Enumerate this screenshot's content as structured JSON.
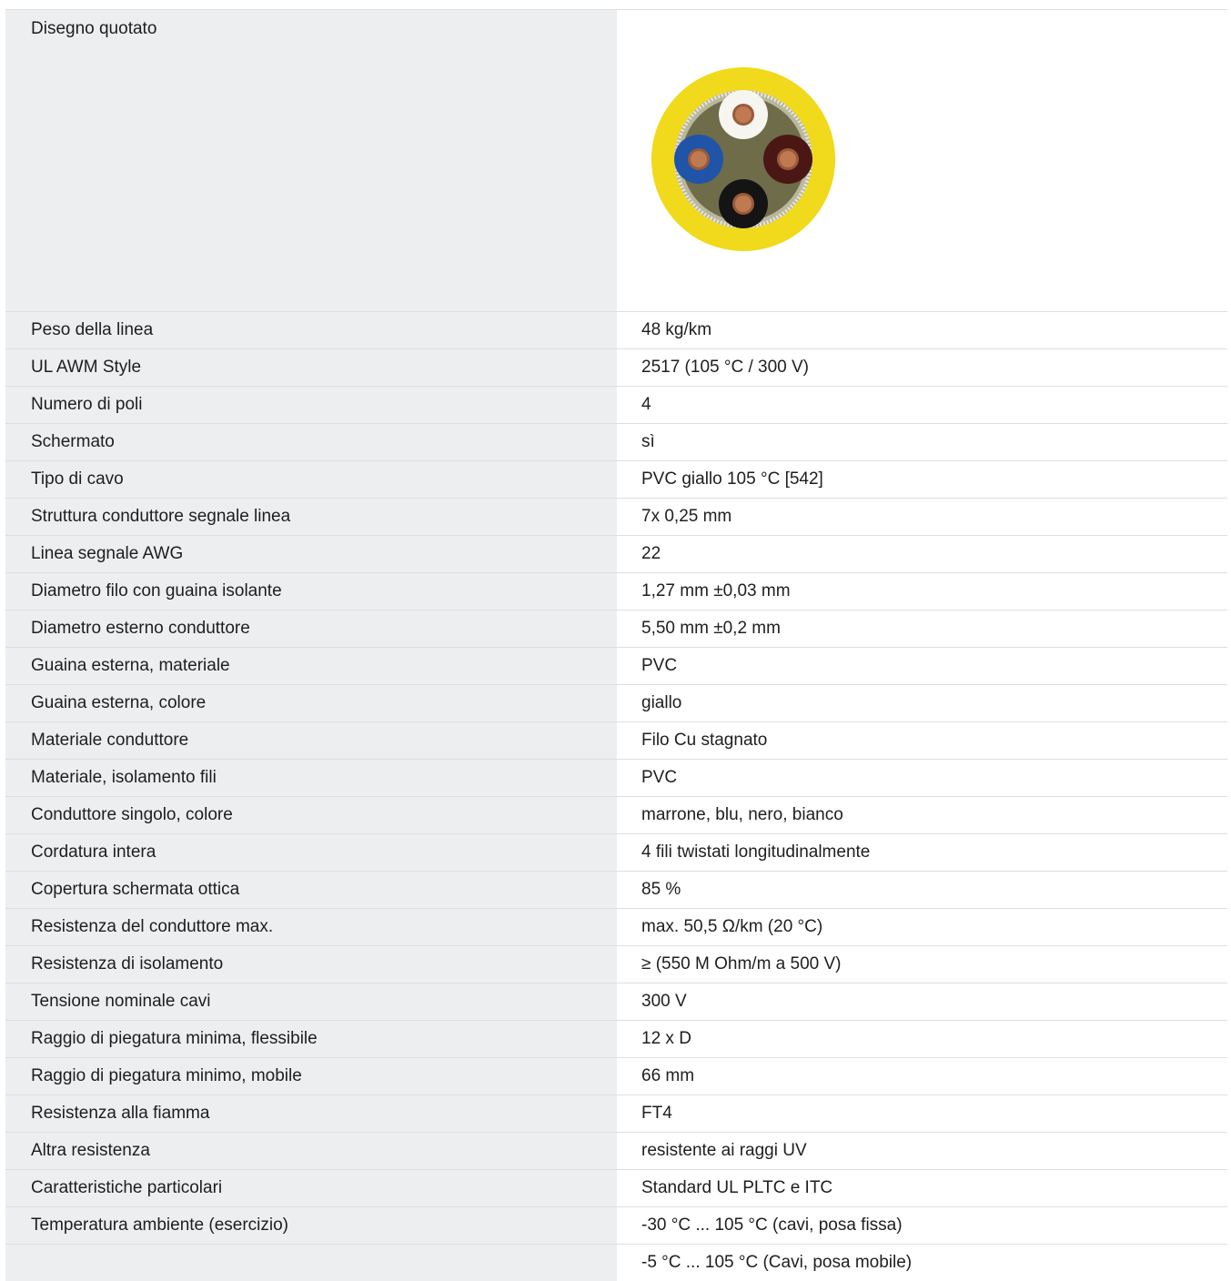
{
  "drawing": {
    "label": "Disegno quotato"
  },
  "properties": [
    {
      "label": "Peso della linea",
      "value": "48 kg/km"
    },
    {
      "label": "UL AWM Style",
      "value": "2517 (105 °C / 300 V)"
    },
    {
      "label": "Numero di poli",
      "value": "4"
    },
    {
      "label": "Schermato",
      "value": "sì"
    },
    {
      "label": "Tipo di cavo",
      "value": "PVC giallo 105 °C [542]"
    },
    {
      "label": "Struttura conduttore segnale linea",
      "value": "7x 0,25 mm"
    },
    {
      "label": "Linea segnale AWG",
      "value": "22"
    },
    {
      "label": "Diametro filo con guaina isolante",
      "value": "1,27 mm ±0,03 mm"
    },
    {
      "label": "Diametro esterno conduttore",
      "value": "5,50 mm ±0,2 mm"
    },
    {
      "label": "Guaina esterna, materiale",
      "value": "PVC"
    },
    {
      "label": "Guaina esterna, colore",
      "value": "giallo"
    },
    {
      "label": "Materiale conduttore",
      "value": "Filo Cu stagnato"
    },
    {
      "label": "Materiale, isolamento fili",
      "value": "PVC"
    },
    {
      "label": "Conduttore singolo, colore",
      "value": "marrone, blu, nero, bianco"
    },
    {
      "label": "Cordatura intera",
      "value": "4 fili twistati longitudinalmente"
    },
    {
      "label": "Copertura schermata ottica",
      "value": "85 %"
    },
    {
      "label": "Resistenza del conduttore max.",
      "value": "max. 50,5 Ω/km (20 °C)"
    },
    {
      "label": "Resistenza di isolamento",
      "value": "≥ (550 M Ohm/m a 500 V)"
    },
    {
      "label": "Tensione nominale cavi",
      "value": "300 V"
    },
    {
      "label": "Raggio di piegatura minima, flessibile",
      "value": "12 x D"
    },
    {
      "label": "Raggio di piegatura minimo, mobile",
      "value": "66 mm"
    },
    {
      "label": "Resistenza alla fiamma",
      "value": "FT4"
    },
    {
      "label": "Altra resistenza",
      "value": "resistente ai raggi UV"
    },
    {
      "label": "Caratteristiche particolari",
      "value": "Standard UL PLTC e ITC"
    },
    {
      "label": "Temperatura ambiente (esercizio)",
      "value": "-30 °C ... 105 °C (cavi, posa fissa)"
    },
    {
      "label": "",
      "value": "-5 °C ... 105 °C (Cavi, posa mobile)"
    }
  ]
}
